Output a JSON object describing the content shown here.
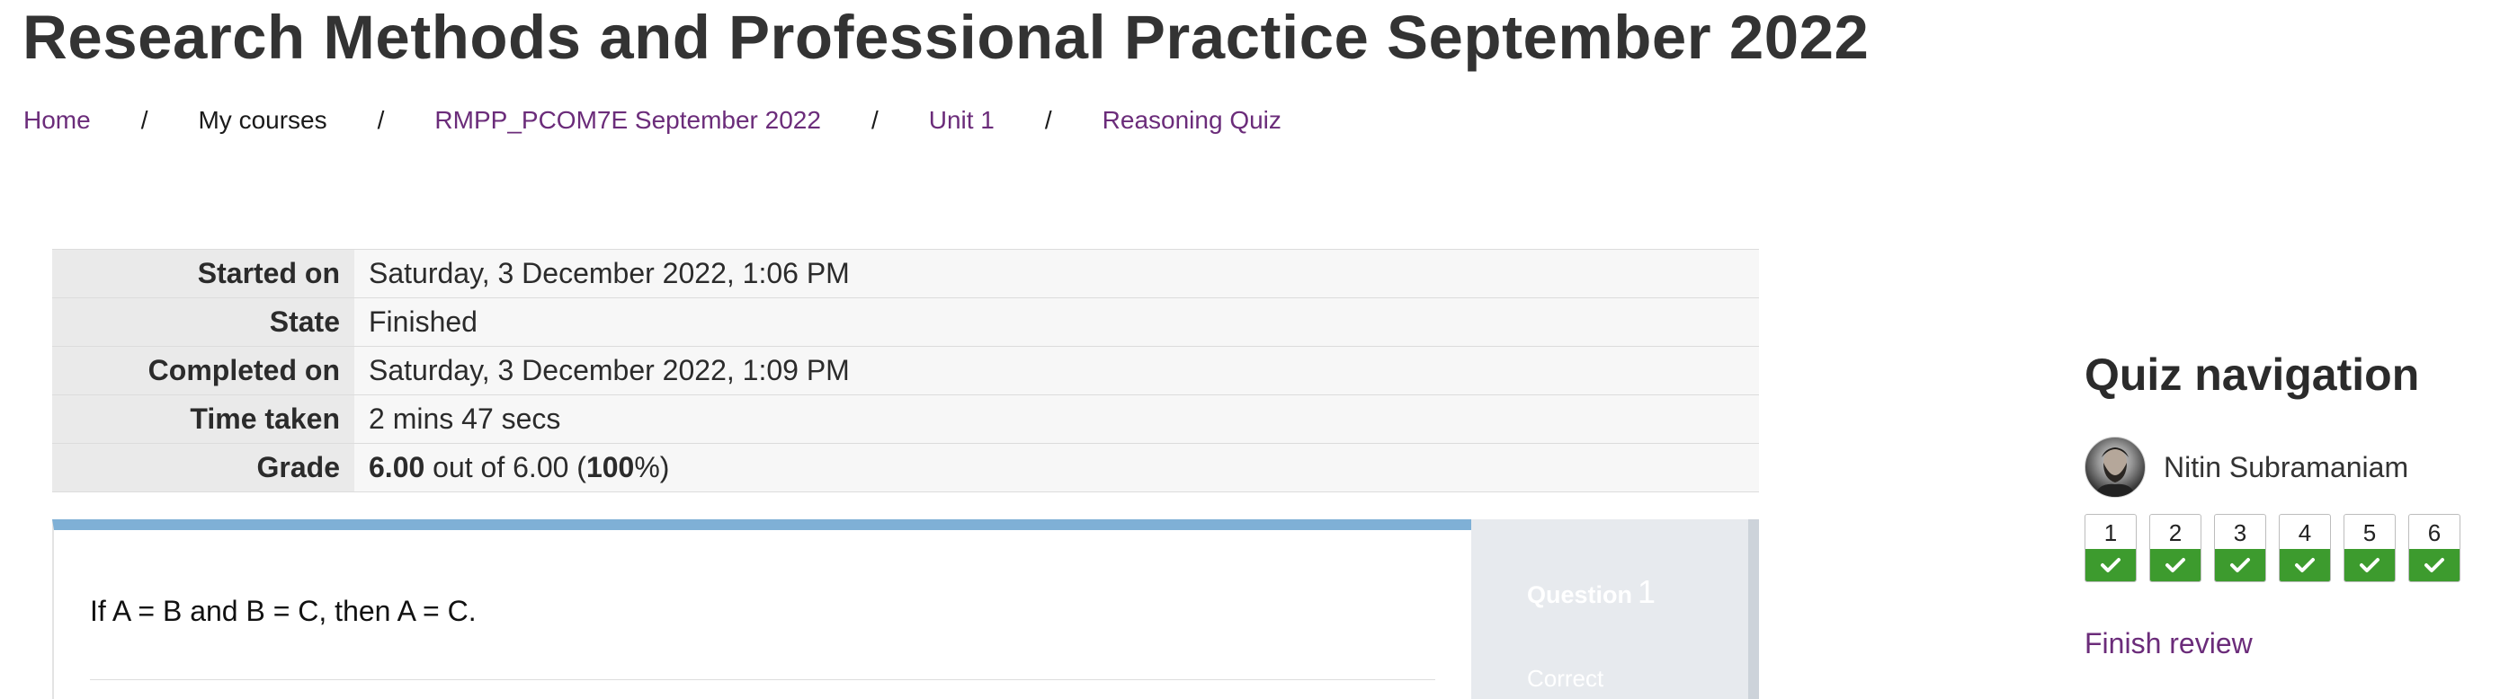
{
  "page": {
    "title": "Research Methods and Professional Practice September 2022"
  },
  "breadcrumb": {
    "items": [
      {
        "label": "Home"
      },
      {
        "label": "My courses"
      },
      {
        "label": "RMPP_PCOM7E September 2022"
      },
      {
        "label": "Unit 1"
      },
      {
        "label": "Reasoning Quiz"
      }
    ],
    "separator": "/"
  },
  "summary": {
    "rows": [
      {
        "label": "Started on",
        "value": "Saturday, 3 December 2022, 1:06 PM"
      },
      {
        "label": "State",
        "value": "Finished"
      },
      {
        "label": "Completed on",
        "value": "Saturday, 3 December 2022, 1:09 PM"
      },
      {
        "label": "Time taken",
        "value": "2 mins 47 secs"
      }
    ],
    "grade": {
      "label": "Grade",
      "score": "6.00",
      "out_of_text": " out of 6.00 (",
      "percent": "100",
      "suffix": "%)"
    }
  },
  "question": {
    "prefix": "Question",
    "number": "1",
    "state": "Correct",
    "text": "If A = B and B = C, then A = C."
  },
  "quiz_nav": {
    "title": "Quiz navigation",
    "user_name": "Nitin Subramaniam",
    "buttons": [
      {
        "label": "1",
        "status": "correct"
      },
      {
        "label": "2",
        "status": "correct"
      },
      {
        "label": "3",
        "status": "correct"
      },
      {
        "label": "4",
        "status": "correct"
      },
      {
        "label": "5",
        "status": "correct"
      },
      {
        "label": "6",
        "status": "correct"
      }
    ],
    "finish_review": "Finish review"
  },
  "colors": {
    "link": "#6b2c7a",
    "correct": "#3d9b2e",
    "question_accent": "#7fb0d6",
    "question_info_bg": "#e7eaee"
  }
}
